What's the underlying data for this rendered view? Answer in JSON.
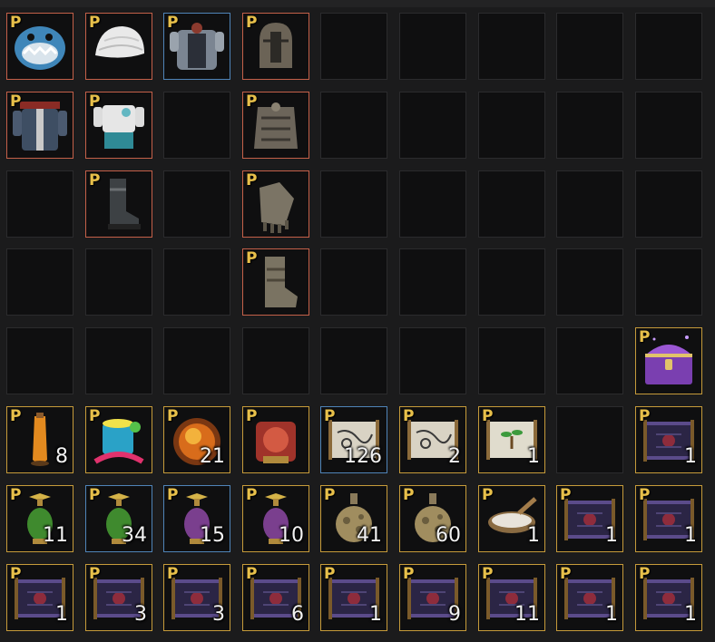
{
  "inventory": {
    "colors": {
      "empty_bg": "#0f0f10",
      "empty_border": "#2b2b2d",
      "red": "#c46049",
      "blue": "#4f84b8",
      "gold": "#c69b3a",
      "premium_badge": "#e8c04a"
    },
    "slots": [
      {
        "icon": "shark-helmet",
        "badge": "P",
        "frame": "red",
        "qty": ""
      },
      {
        "icon": "white-bandana",
        "badge": "P",
        "frame": "red",
        "qty": ""
      },
      {
        "icon": "plate-armor-blue",
        "badge": "P",
        "frame": "blue",
        "qty": ""
      },
      {
        "icon": "knight-helmet",
        "badge": "P",
        "frame": "red",
        "qty": ""
      },
      {
        "icon": "",
        "badge": "",
        "frame": "empty",
        "qty": ""
      },
      {
        "icon": "",
        "badge": "",
        "frame": "empty",
        "qty": ""
      },
      {
        "icon": "",
        "badge": "",
        "frame": "empty",
        "qty": ""
      },
      {
        "icon": "",
        "badge": "",
        "frame": "empty",
        "qty": ""
      },
      {
        "icon": "",
        "badge": "",
        "frame": "empty",
        "qty": ""
      },
      {
        "icon": "pirate-coat",
        "badge": "P",
        "frame": "red",
        "qty": ""
      },
      {
        "icon": "white-outfit",
        "badge": "P",
        "frame": "red",
        "qty": ""
      },
      {
        "icon": "",
        "badge": "",
        "frame": "empty",
        "qty": ""
      },
      {
        "icon": "plate-armor",
        "badge": "P",
        "frame": "red",
        "qty": ""
      },
      {
        "icon": "",
        "badge": "",
        "frame": "empty",
        "qty": ""
      },
      {
        "icon": "",
        "badge": "",
        "frame": "empty",
        "qty": ""
      },
      {
        "icon": "",
        "badge": "",
        "frame": "empty",
        "qty": ""
      },
      {
        "icon": "",
        "badge": "",
        "frame": "empty",
        "qty": ""
      },
      {
        "icon": "",
        "badge": "",
        "frame": "empty",
        "qty": ""
      },
      {
        "icon": "",
        "badge": "",
        "frame": "empty",
        "qty": ""
      },
      {
        "icon": "leather-boots",
        "badge": "P",
        "frame": "red",
        "qty": ""
      },
      {
        "icon": "",
        "badge": "",
        "frame": "empty",
        "qty": ""
      },
      {
        "icon": "plate-gauntlets",
        "badge": "P",
        "frame": "red",
        "qty": ""
      },
      {
        "icon": "",
        "badge": "",
        "frame": "empty",
        "qty": ""
      },
      {
        "icon": "",
        "badge": "",
        "frame": "empty",
        "qty": ""
      },
      {
        "icon": "",
        "badge": "",
        "frame": "empty",
        "qty": ""
      },
      {
        "icon": "",
        "badge": "",
        "frame": "empty",
        "qty": ""
      },
      {
        "icon": "",
        "badge": "",
        "frame": "empty",
        "qty": ""
      },
      {
        "icon": "",
        "badge": "",
        "frame": "empty",
        "qty": ""
      },
      {
        "icon": "",
        "badge": "",
        "frame": "empty",
        "qty": ""
      },
      {
        "icon": "",
        "badge": "",
        "frame": "empty",
        "qty": ""
      },
      {
        "icon": "plate-boots",
        "badge": "P",
        "frame": "red",
        "qty": ""
      },
      {
        "icon": "",
        "badge": "",
        "frame": "empty",
        "qty": ""
      },
      {
        "icon": "",
        "badge": "",
        "frame": "empty",
        "qty": ""
      },
      {
        "icon": "",
        "badge": "",
        "frame": "empty",
        "qty": ""
      },
      {
        "icon": "",
        "badge": "",
        "frame": "empty",
        "qty": ""
      },
      {
        "icon": "",
        "badge": "",
        "frame": "empty",
        "qty": ""
      },
      {
        "icon": "",
        "badge": "",
        "frame": "empty",
        "qty": ""
      },
      {
        "icon": "",
        "badge": "",
        "frame": "empty",
        "qty": ""
      },
      {
        "icon": "",
        "badge": "",
        "frame": "empty",
        "qty": ""
      },
      {
        "icon": "",
        "badge": "",
        "frame": "empty",
        "qty": ""
      },
      {
        "icon": "",
        "badge": "",
        "frame": "empty",
        "qty": ""
      },
      {
        "icon": "",
        "badge": "",
        "frame": "empty",
        "qty": ""
      },
      {
        "icon": "",
        "badge": "",
        "frame": "empty",
        "qty": ""
      },
      {
        "icon": "",
        "badge": "",
        "frame": "empty",
        "qty": ""
      },
      {
        "icon": "purple-treasure-chest",
        "badge": "P",
        "frame": "gold",
        "qty": ""
      },
      {
        "icon": "orange-potion",
        "badge": "P",
        "frame": "gold",
        "qty": "8"
      },
      {
        "icon": "dye-bucket",
        "badge": "P",
        "frame": "gold",
        "qty": ""
      },
      {
        "icon": "fire-orb",
        "badge": "P",
        "frame": "gold",
        "qty": "21"
      },
      {
        "icon": "red-emblem",
        "badge": "P",
        "frame": "gold",
        "qty": ""
      },
      {
        "icon": "map-scroll",
        "badge": "P",
        "frame": "blue",
        "qty": "126"
      },
      {
        "icon": "map-scroll",
        "badge": "P",
        "frame": "gold",
        "qty": "2"
      },
      {
        "icon": "seedling-scroll",
        "badge": "P",
        "frame": "gold",
        "qty": "1"
      },
      {
        "icon": "",
        "badge": "",
        "frame": "empty",
        "qty": ""
      },
      {
        "icon": "purple-scroll",
        "badge": "P",
        "frame": "gold",
        "qty": "1"
      },
      {
        "icon": "green-elixir",
        "badge": "P",
        "frame": "gold",
        "qty": "11"
      },
      {
        "icon": "green-elixir",
        "badge": "P",
        "frame": "blue",
        "qty": "34"
      },
      {
        "icon": "purple-elixir",
        "badge": "P",
        "frame": "blue",
        "qty": "15"
      },
      {
        "icon": "purple-elixir",
        "badge": "P",
        "frame": "gold",
        "qty": "10"
      },
      {
        "icon": "stone-flask",
        "badge": "P",
        "frame": "gold",
        "qty": "41"
      },
      {
        "icon": "stone-flask",
        "badge": "P",
        "frame": "gold",
        "qty": "60"
      },
      {
        "icon": "wooden-bowl",
        "badge": "P",
        "frame": "gold",
        "qty": "1"
      },
      {
        "icon": "purple-scroll",
        "badge": "P",
        "frame": "gold",
        "qty": "1"
      },
      {
        "icon": "purple-scroll",
        "badge": "P",
        "frame": "gold",
        "qty": "1"
      },
      {
        "icon": "purple-scroll",
        "badge": "P",
        "frame": "gold",
        "qty": "1"
      },
      {
        "icon": "purple-scroll",
        "badge": "P",
        "frame": "gold",
        "qty": "3"
      },
      {
        "icon": "purple-scroll",
        "badge": "P",
        "frame": "gold",
        "qty": "3"
      },
      {
        "icon": "purple-scroll",
        "badge": "P",
        "frame": "gold",
        "qty": "6"
      },
      {
        "icon": "purple-scroll",
        "badge": "P",
        "frame": "gold",
        "qty": "1"
      },
      {
        "icon": "purple-scroll",
        "badge": "P",
        "frame": "gold",
        "qty": "9"
      },
      {
        "icon": "purple-scroll",
        "badge": "P",
        "frame": "gold",
        "qty": "11"
      },
      {
        "icon": "purple-scroll",
        "badge": "P",
        "frame": "gold",
        "qty": "1"
      },
      {
        "icon": "purple-scroll",
        "badge": "P",
        "frame": "gold",
        "qty": "1"
      }
    ]
  }
}
